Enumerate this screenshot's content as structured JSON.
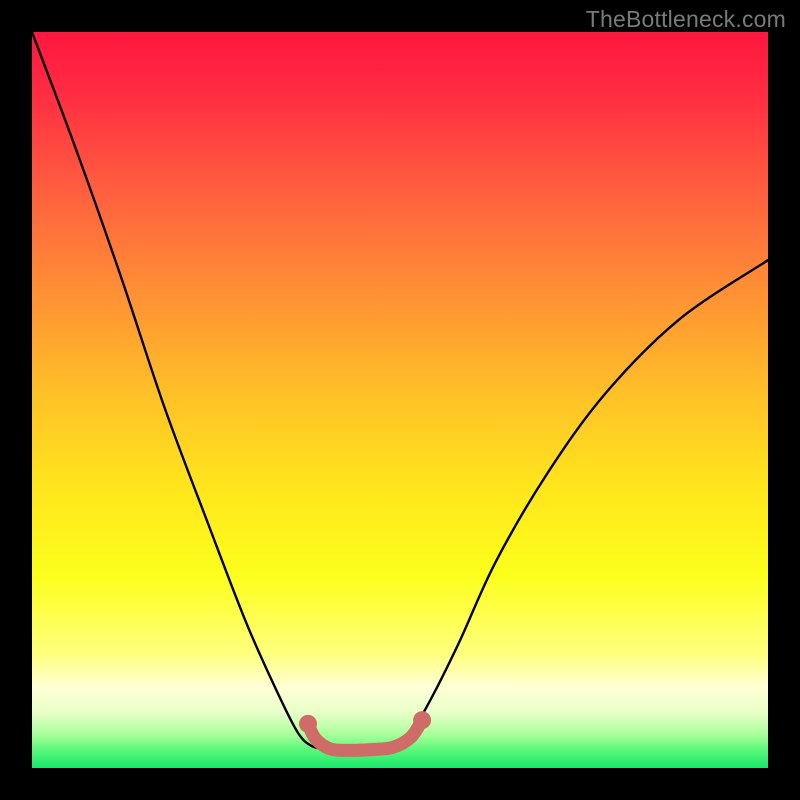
{
  "watermark": "TheBottleneck.com",
  "chart_data": {
    "type": "line",
    "title": "",
    "xlabel": "",
    "ylabel": "",
    "xlim": [
      0,
      100
    ],
    "ylim": [
      0,
      100
    ],
    "gradient_stops": [
      {
        "offset": 0,
        "color": "#ff173f"
      },
      {
        "offset": 0.08,
        "color": "#ff2b42"
      },
      {
        "offset": 0.2,
        "color": "#ff5940"
      },
      {
        "offset": 0.35,
        "color": "#ff8f35"
      },
      {
        "offset": 0.5,
        "color": "#ffc327"
      },
      {
        "offset": 0.62,
        "color": "#ffe61c"
      },
      {
        "offset": 0.74,
        "color": "#fcff1c"
      },
      {
        "offset": 0.845,
        "color": "#ffff7e"
      },
      {
        "offset": 0.89,
        "color": "#ffffd6"
      },
      {
        "offset": 0.925,
        "color": "#e8ffc8"
      },
      {
        "offset": 0.955,
        "color": "#a8ff9a"
      },
      {
        "offset": 0.975,
        "color": "#5cf87a"
      },
      {
        "offset": 1.0,
        "color": "#18e86a"
      }
    ],
    "series": [
      {
        "name": "bottleneck-curve",
        "x": [
          0,
          6,
          12,
          18,
          24,
          29,
          33,
          36,
          38,
          40.5,
          43,
          46,
          49,
          51.5,
          54,
          58,
          63,
          70,
          78,
          88,
          100
        ],
        "y": [
          100,
          84,
          67,
          49,
          33,
          20,
          11,
          5,
          3,
          2.5,
          2.5,
          2.6,
          3.2,
          5,
          9,
          17,
          28,
          40,
          51,
          61,
          69
        ]
      }
    ],
    "trough_marker": {
      "name": "optimum-band",
      "color": "#cf6c67",
      "points": [
        {
          "x": 37.5,
          "y": 6.0
        },
        {
          "x": 38.5,
          "y": 4.0
        },
        {
          "x": 40.5,
          "y": 2.6
        },
        {
          "x": 43.0,
          "y": 2.4
        },
        {
          "x": 46.0,
          "y": 2.5
        },
        {
          "x": 49.0,
          "y": 2.8
        },
        {
          "x": 51.5,
          "y": 4.2
        },
        {
          "x": 53.0,
          "y": 6.5
        }
      ]
    }
  }
}
